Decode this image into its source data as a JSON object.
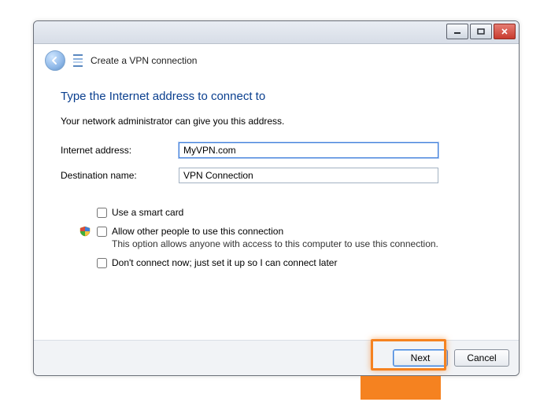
{
  "window": {
    "title": "Create a VPN connection"
  },
  "heading": "Type the Internet address to connect to",
  "subtext": "Your network administrator can give you this address.",
  "fields": {
    "internet": {
      "label": "Internet address:",
      "value": "MyVPN.com"
    },
    "destination": {
      "label": "Destination name:",
      "value": "VPN Connection"
    }
  },
  "options": {
    "smartcard": {
      "label": "Use a smart card",
      "checked": false
    },
    "allow_others": {
      "label": "Allow other people to use this connection",
      "sub": "This option allows anyone with access to this computer to use this connection.",
      "checked": false
    },
    "defer": {
      "label": "Don't connect now; just set it up so I can connect later",
      "checked": false
    }
  },
  "buttons": {
    "next": "Next",
    "cancel": "Cancel"
  },
  "highlight_color": "#f58220"
}
